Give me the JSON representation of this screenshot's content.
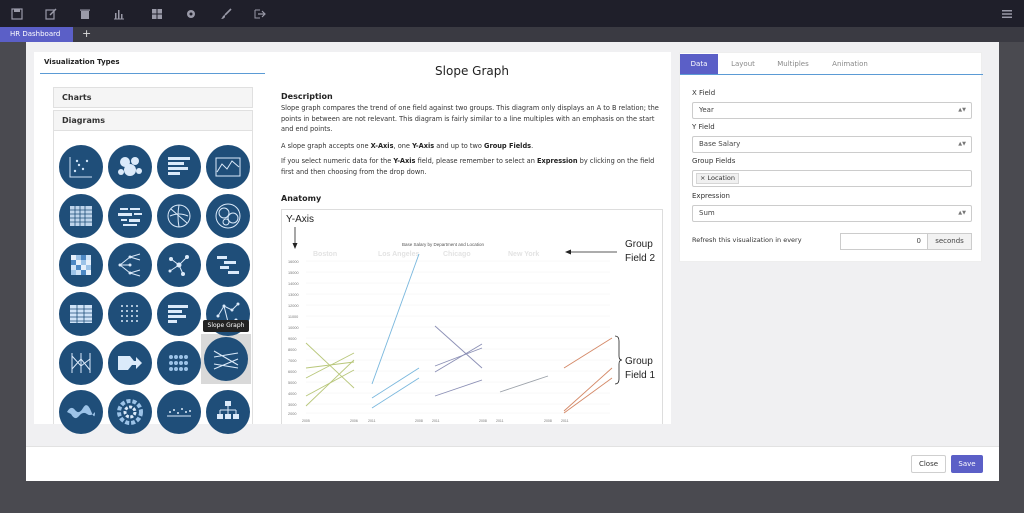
{
  "topbar": {
    "icons": [
      "save-icon",
      "edit-icon",
      "trash-icon",
      "bar-chart-icon",
      "dashboard-icon",
      "gear-icon",
      "brush-icon",
      "export-icon",
      "menu-icon"
    ]
  },
  "tabs": {
    "active_label": "HR Dashboard",
    "add_label": "+"
  },
  "left_panel": {
    "title": "Visualization Types",
    "sections": [
      "Charts",
      "Diagrams"
    ],
    "tooltip": "Slope Graph"
  },
  "middle": {
    "title": "Slope Graph",
    "description_heading": "Description",
    "description_p1": "Slope graph compares the trend of one field against two groups. This diagram only displays an A to B relation; the points in between are not relevant. This diagram is fairly similar to a line multiples with an emphasis on the start and end points.",
    "description_p2_parts": [
      "A slope graph accepts one ",
      "X-Axis",
      ", one ",
      "Y-Axis",
      " and up to two ",
      "Group Fields",
      "."
    ],
    "description_p3_parts": [
      "If you select numeric data for the ",
      "Y-Axis",
      " field, please remember to select an ",
      "Expression",
      " by clicking on the field first and then choosing from the drop down."
    ],
    "anatomy_heading": "Anatomy",
    "anatomy": {
      "yaxis_label": "Y-Axis",
      "chart_title": "Base Salary by Department and Location",
      "group_field_2": [
        "Group",
        "Field 2"
      ],
      "group_field_1": [
        "Group",
        "Field 1"
      ],
      "columns": [
        "Boston",
        "Los Angeles",
        "Chicago",
        "New York"
      ],
      "y_ticks": [
        "16000",
        "15000",
        "14000",
        "13000",
        "12000",
        "11000",
        "10000",
        "9000",
        "8000",
        "7000",
        "6000",
        "5000",
        "4000",
        "3000",
        "2000"
      ],
      "x_ticks": [
        "2005",
        "2006",
        "2011",
        "2008",
        "2011",
        "2008",
        "2011",
        "2008",
        "2011"
      ]
    }
  },
  "right_panel": {
    "tabs": [
      "Data",
      "Layout",
      "Multiples",
      "Animation"
    ],
    "active_tab": "Data",
    "x_field_label": "X Field",
    "x_field_value": "Year",
    "y_field_label": "Y Field",
    "y_field_value": "Base Salary",
    "group_fields_label": "Group Fields",
    "group_fields_chip": "× Location",
    "expression_label": "Expression",
    "expression_value": "Sum",
    "refresh_label": "Refresh this visualization in every",
    "refresh_value": "0",
    "refresh_unit": "seconds",
    "active_tab_color": "#5b5fc7"
  },
  "footer": {
    "close_label": "Close",
    "save_label": "Save"
  }
}
